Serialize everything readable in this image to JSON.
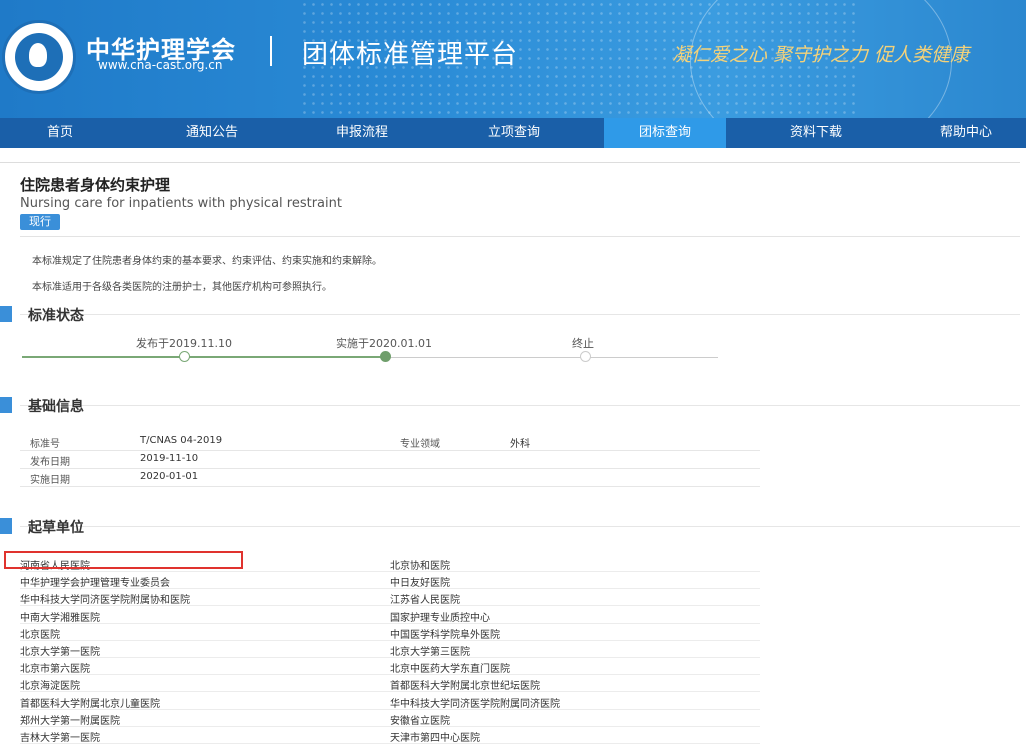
{
  "header": {
    "org_name": "中华护理学会",
    "org_url": "www.cna-cast.org.cn",
    "platform_title": "团体标准管理平台",
    "slogan": "凝仁爱之心 聚守护之力 促人类健康"
  },
  "nav": {
    "items": [
      {
        "label": "首页"
      },
      {
        "label": "通知公告"
      },
      {
        "label": "申报流程"
      },
      {
        "label": "立项查询"
      },
      {
        "label": "团标查询",
        "active": true
      },
      {
        "label": "资料下载"
      },
      {
        "label": "帮助中心"
      }
    ]
  },
  "standard": {
    "title_cn": "住院患者身体约束护理",
    "title_en": "Nursing care for inpatients with physical restraint",
    "badge": "现行",
    "desc1": "本标准规定了住院患者身体约束的基本要求、约束评估、约束实施和约束解除。",
    "desc2": "本标准适用于各级各类医院的注册护士，其他医疗机构可参照执行。"
  },
  "status_section": {
    "title": "标准状态",
    "steps": [
      {
        "label": "发布于2019.11.10",
        "state": "done"
      },
      {
        "label": "实施于2020.01.01",
        "state": "current"
      },
      {
        "label": "终止",
        "state": "pending"
      }
    ]
  },
  "basic_info": {
    "title": "基础信息",
    "rows": [
      {
        "label": "标准号",
        "value": "T/CNAS 04-2019",
        "label2": "专业领域",
        "value2": "外科"
      },
      {
        "label": "发布日期",
        "value": "2019-11-10"
      },
      {
        "label": "实施日期",
        "value": "2020-01-01"
      }
    ]
  },
  "drafters": {
    "title": "起草单位",
    "left": [
      "河南省人民医院",
      "中华护理学会护理管理专业委员会",
      "华中科技大学同济医学院附属协和医院",
      "中南大学湘雅医院",
      "北京医院",
      "北京大学第一医院",
      "北京市第六医院",
      "北京海淀医院",
      "首都医科大学附属北京儿童医院",
      "郑州大学第一附属医院",
      "吉林大学第一医院"
    ],
    "right": [
      "北京协和医院",
      "中日友好医院",
      "江苏省人民医院",
      "国家护理专业质控中心",
      "中国医学科学院阜外医院",
      "北京大学第三医院",
      "北京中医药大学东直门医院",
      "首都医科大学附属北京世纪坛医院",
      "华中科技大学同济医学院附属同济医院",
      "安徽省立医院",
      "天津市第四中心医院"
    ]
  }
}
